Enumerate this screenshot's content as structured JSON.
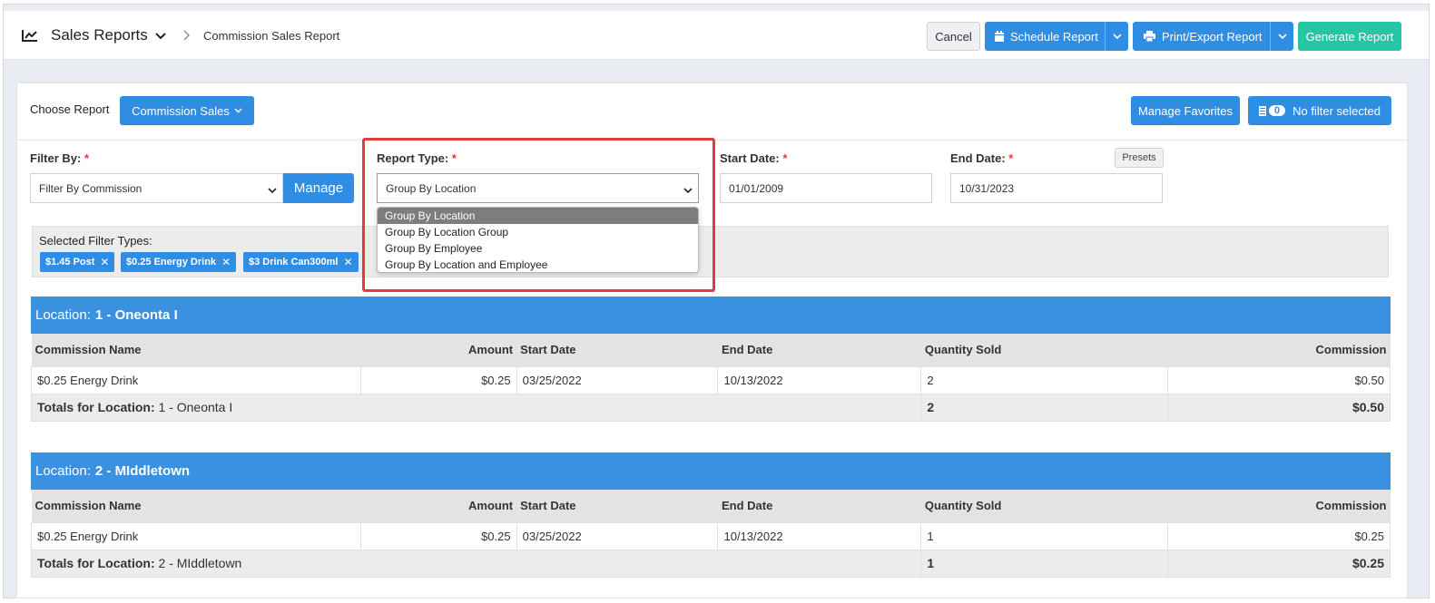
{
  "header": {
    "title": "Sales Reports",
    "breadcrumb": "Commission Sales Report",
    "cancel_label": "Cancel",
    "schedule_label": "Schedule Report",
    "print_label": "Print/Export Report",
    "generate_label": "Generate Report"
  },
  "toolbar": {
    "choose_report_label": "Choose Report",
    "choose_report_value": "Commission Sales",
    "manage_favorites_label": "Manage Favorites",
    "filter_count": "0",
    "filter_status": "No filter selected"
  },
  "filters": {
    "filter_by_label": "Filter By:",
    "filter_by_value": "Filter By Commission",
    "manage_label": "Manage",
    "report_type_label": "Report Type:",
    "report_type_value": "Group By Location",
    "report_type_options": [
      "Group By Location",
      "Group By Location Group",
      "Group By Employee",
      "Group By Location and Employee"
    ],
    "start_date_label": "Start Date:",
    "start_date_value": "01/01/2009",
    "end_date_label": "End Date:",
    "end_date_value": "10/31/2023",
    "presets_label": "Presets",
    "required_mark": "*",
    "selected_types_label": "Selected Filter Types:",
    "chips": [
      "$1.45 Post",
      "$0.25 Energy Drink",
      "$3 Drink Can300ml"
    ]
  },
  "columns": [
    "Commission Name",
    "Amount",
    "Start Date",
    "End Date",
    "Quantity Sold",
    "Commission"
  ],
  "locations": [
    {
      "prefix": "Location:",
      "name": "1 - Oneonta I",
      "rows": [
        {
          "commission_name": "$0.25 Energy Drink",
          "amount": "$0.25",
          "start": "03/25/2022",
          "end": "10/13/2022",
          "qty": "2",
          "commission": "$0.50"
        }
      ],
      "totals_label": "Totals for Location:",
      "totals_name": "1 - Oneonta I",
      "totals_qty": "2",
      "totals_commission": "$0.50"
    },
    {
      "prefix": "Location:",
      "name": "2 - MIddletown",
      "rows": [
        {
          "commission_name": "$0.25 Energy Drink",
          "amount": "$0.25",
          "start": "03/25/2022",
          "end": "10/13/2022",
          "qty": "1",
          "commission": "$0.25"
        }
      ],
      "totals_label": "Totals for Location:",
      "totals_name": "2 - MIddletown",
      "totals_qty": "1",
      "totals_commission": "$0.25"
    }
  ],
  "colors": {
    "primary": "#2f8de4",
    "teal": "#26c6a4",
    "location_bar": "#3a91df",
    "highlight": "#e23b3b"
  }
}
